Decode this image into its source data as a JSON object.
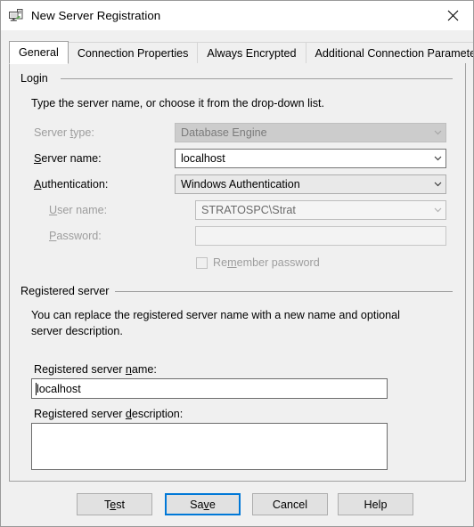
{
  "window": {
    "title": "New Server Registration",
    "icon": "server-registration-icon",
    "close_label": "×"
  },
  "tabs": [
    {
      "label": "General",
      "selected": true
    },
    {
      "label": "Connection Properties",
      "selected": false
    },
    {
      "label": "Always Encrypted",
      "selected": false
    },
    {
      "label": "Additional Connection Parameters",
      "selected": false
    }
  ],
  "login_group": {
    "legend": "Login",
    "instruction": "Type the server name, or choose it from the drop-down list.",
    "server_type": {
      "label_before": "Server ",
      "label_accel": "t",
      "label_after": "ype:",
      "value": "Database Engine",
      "enabled": false
    },
    "server_name": {
      "label_accel": "S",
      "label_after": "erver name:",
      "value": "localhost",
      "enabled": true
    },
    "authentication": {
      "label_accel": "A",
      "label_after": "uthentication:",
      "value": "Windows Authentication",
      "enabled": true
    },
    "user_name": {
      "label_accel": "U",
      "label_after": "ser name:",
      "value": "STRATOSPC\\Strat",
      "enabled": false
    },
    "password": {
      "label_accel": "P",
      "label_after": "assword:",
      "value": "",
      "enabled": false
    },
    "remember_password": {
      "label_before": "Re",
      "label_accel": "m",
      "label_after": "ember password",
      "checked": false,
      "enabled": false
    }
  },
  "registered_group": {
    "legend": "Registered server",
    "instruction": "You can replace the registered server name with a new name and optional\nserver description.",
    "name_field": {
      "label_before": "Registered server ",
      "label_accel": "n",
      "label_after": "ame:",
      "value": "localhost"
    },
    "description_field": {
      "label_before": "Registered server ",
      "label_accel": "d",
      "label_after": "escription:",
      "value": ""
    }
  },
  "buttons": [
    {
      "name": "test",
      "label_before": "T",
      "label_accel": "e",
      "label_after": "st",
      "default": false
    },
    {
      "name": "save",
      "label_before": "Sa",
      "label_accel": "v",
      "label_after": "e",
      "default": true
    },
    {
      "name": "cancel",
      "label_before": "Cancel",
      "label_accel": "",
      "label_after": "",
      "default": false
    },
    {
      "name": "help",
      "label_before": "Help",
      "label_accel": "",
      "label_after": "",
      "default": false
    }
  ],
  "colors": {
    "dialog_bg": "#f0f0f0",
    "titlebar_bg": "#ffffff",
    "accent_focus": "#0078d7",
    "disabled_text": "#9d9d9d",
    "field_border": "#767676"
  }
}
